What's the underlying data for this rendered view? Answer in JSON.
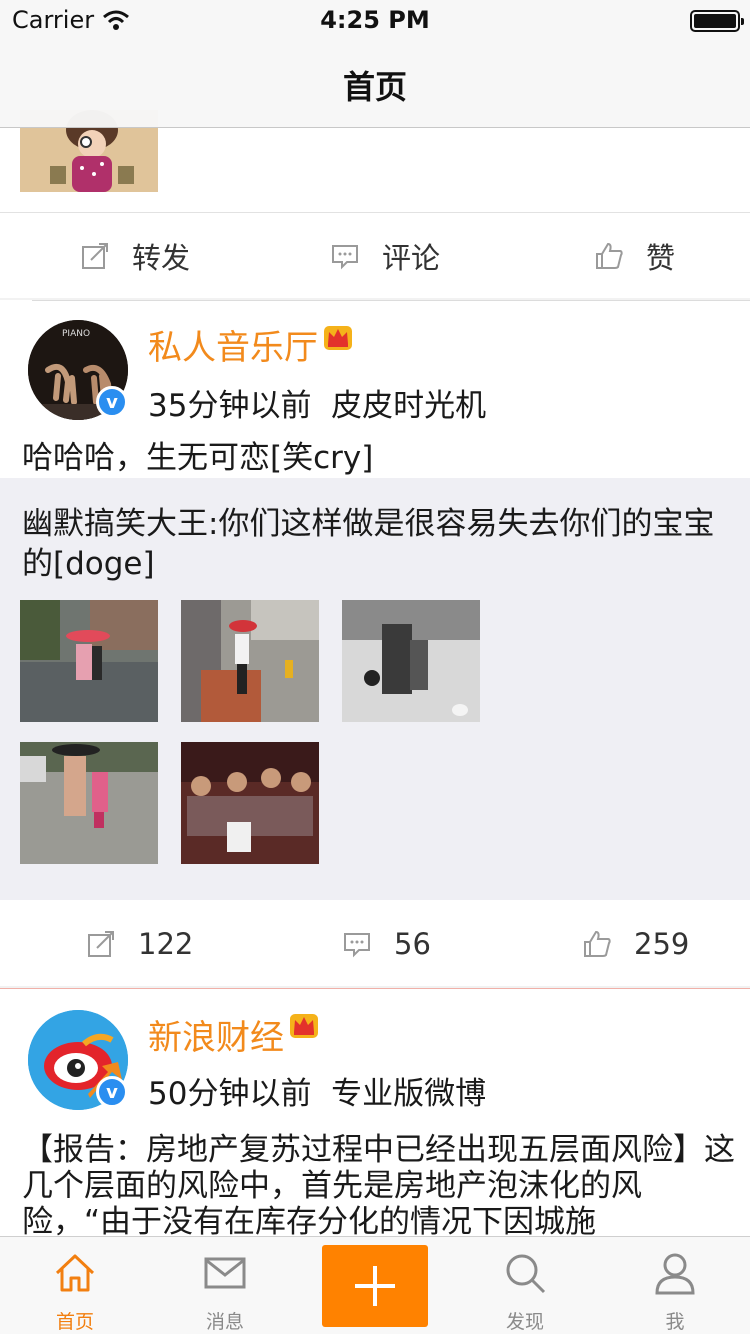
{
  "status_bar": {
    "carrier": "Carrier",
    "time": "4:25 PM"
  },
  "nav": {
    "title": "首页"
  },
  "prev_post": {
    "actions": {
      "repost": "转发",
      "comment": "评论",
      "like": "赞"
    }
  },
  "post1": {
    "author": "私人音乐厅",
    "time": "35分钟以前",
    "source": "皮皮时光机",
    "text": "哈哈哈，生无可恋[笑cry]",
    "repost_text": "幽默搞笑大王:你们这样做是很容易失去你们的宝宝的[doge]",
    "image_count": 5,
    "counts": {
      "reposts": "122",
      "comments": "56",
      "likes": "259"
    },
    "verified_mark": "v"
  },
  "post2": {
    "author": "新浪财经",
    "time": "50分钟以前",
    "source": "专业版微博",
    "text": "【报告：房地产复苏过程中已经出现五层面风险】这几个层面的风险中，首先是房地产泡沫化的风险，“由于没有在库存分化的情况下因城施",
    "verified_mark": "v"
  },
  "tabbar": {
    "items": [
      {
        "label": "首页",
        "icon": "home-icon",
        "active": true
      },
      {
        "label": "消息",
        "icon": "mail-icon",
        "active": false
      },
      {
        "label": "",
        "icon": "plus-icon",
        "active": false
      },
      {
        "label": "发现",
        "icon": "search-icon",
        "active": false
      },
      {
        "label": "我",
        "icon": "person-icon",
        "active": false
      }
    ]
  },
  "colors": {
    "accent": "#ff8200",
    "author_name": "#f28a1c",
    "verified": "#2a8ef0",
    "repost_bg": "#efeff4"
  }
}
